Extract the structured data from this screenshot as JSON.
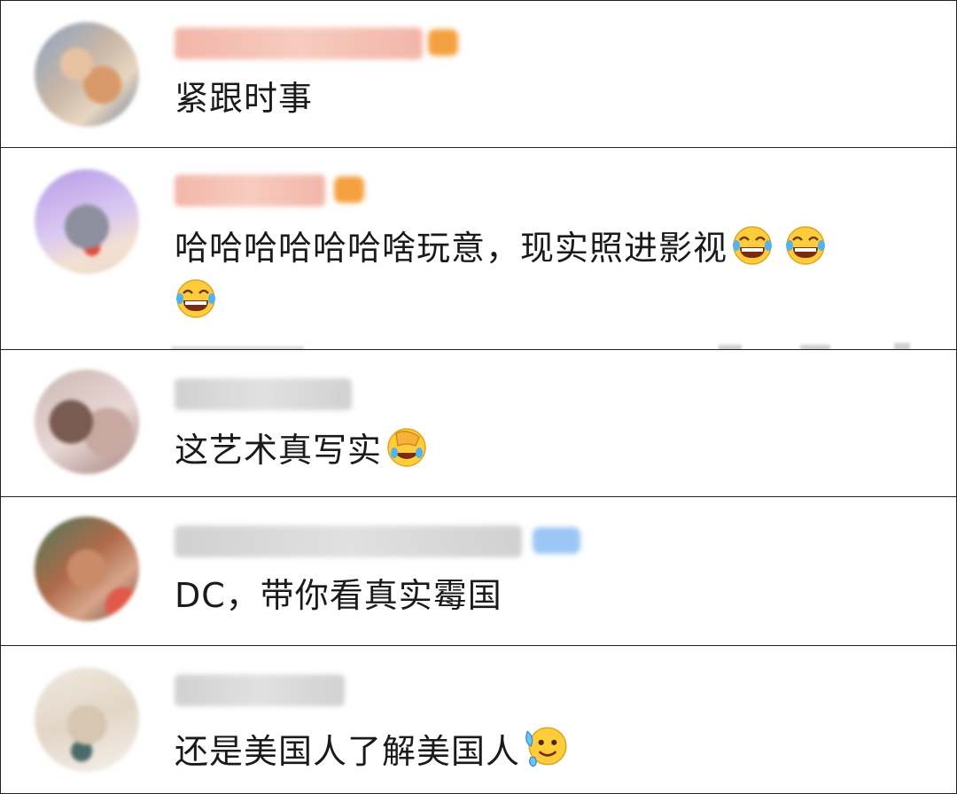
{
  "comments": [
    {
      "text": "紧跟时事",
      "emojis": []
    },
    {
      "text": "哈哈哈哈哈哈啥玩意，现实照进影视",
      "emojis": [
        "laugh-cry-emoji",
        "laugh-cry-emoji",
        "laugh-cry-emoji"
      ]
    },
    {
      "text": "这艺术真写实",
      "emojis": [
        "facepalm-emoji"
      ]
    },
    {
      "text": "DC，带你看真实霉国",
      "emojis": []
    },
    {
      "text": "还是美国人了解美国人",
      "emojis": [
        "cold-sweat-emoji"
      ]
    }
  ],
  "colors": {
    "username_blur": "#f3b7a8",
    "username_gray": "#c9c9c9",
    "badge_orange": "#f5a040",
    "badge_blue": "#9cc6f5"
  }
}
